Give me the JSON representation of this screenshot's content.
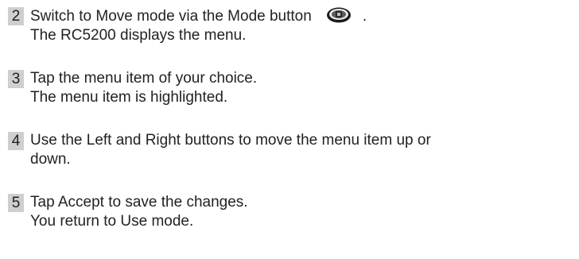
{
  "steps": [
    {
      "number": "2",
      "line1_before_icon": "Switch to Move mode via the Mode button",
      "icon": "mode-button-icon",
      "line1_after_icon": ".",
      "line2": "The RC5200 displays the menu."
    },
    {
      "number": "3",
      "line1": "Tap the menu item of your choice.",
      "line2": "The menu item is highlighted."
    },
    {
      "number": "4",
      "line1": "Use the Left and Right buttons to move the menu item up or",
      "line2": "down."
    },
    {
      "number": "5",
      "line1": "Tap Accept to save the changes.",
      "line2": "You return to Use mode."
    }
  ]
}
